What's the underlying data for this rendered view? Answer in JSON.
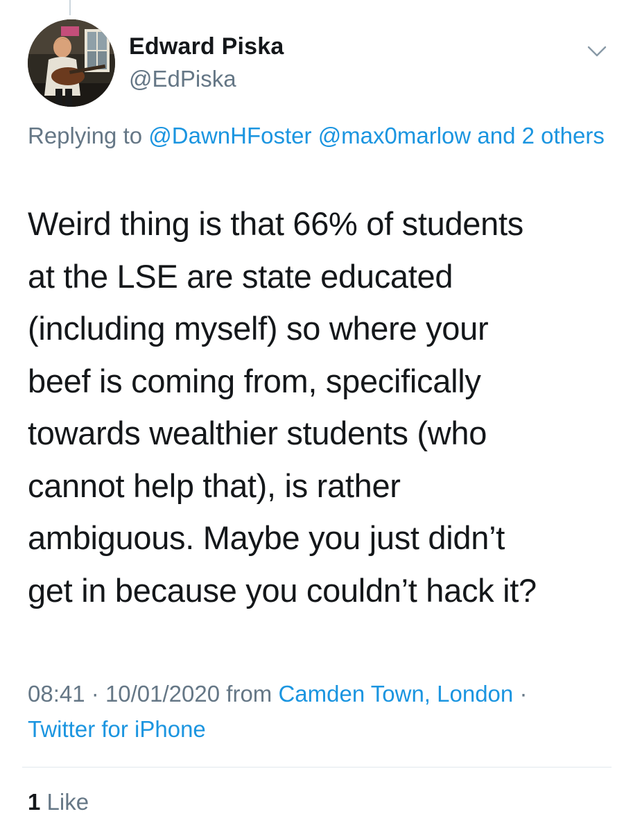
{
  "author": {
    "name": "Edward Piska",
    "handle": "@EdPiska"
  },
  "reply": {
    "prefix": "Replying to",
    "mention_1": "@DawnHFoster",
    "mention_2": "@max0marlow",
    "and_others": "and 2 others"
  },
  "tweet": {
    "lines": [
      "Weird thing is that 66% of students",
      "at the LSE are state educated",
      "(including myself) so where your",
      "beef is coming from, specifically",
      "towards wealthier students (who",
      "cannot help that), is rather",
      "ambiguous. Maybe you just didn’t",
      "get in because you couldn’t hack it?"
    ]
  },
  "meta": {
    "time": "08:41",
    "date": "10/01/2020",
    "from_label": "from",
    "location": "Camden Town, London",
    "client": "Twitter for iPhone",
    "separator": "·"
  },
  "stats": {
    "like_count": "1",
    "like_label": "Like"
  },
  "icons": {
    "menu": "chevron-down-icon"
  },
  "colors": {
    "link": "#1b95e0",
    "secondary_text": "#657786",
    "primary_text": "#14171a"
  }
}
